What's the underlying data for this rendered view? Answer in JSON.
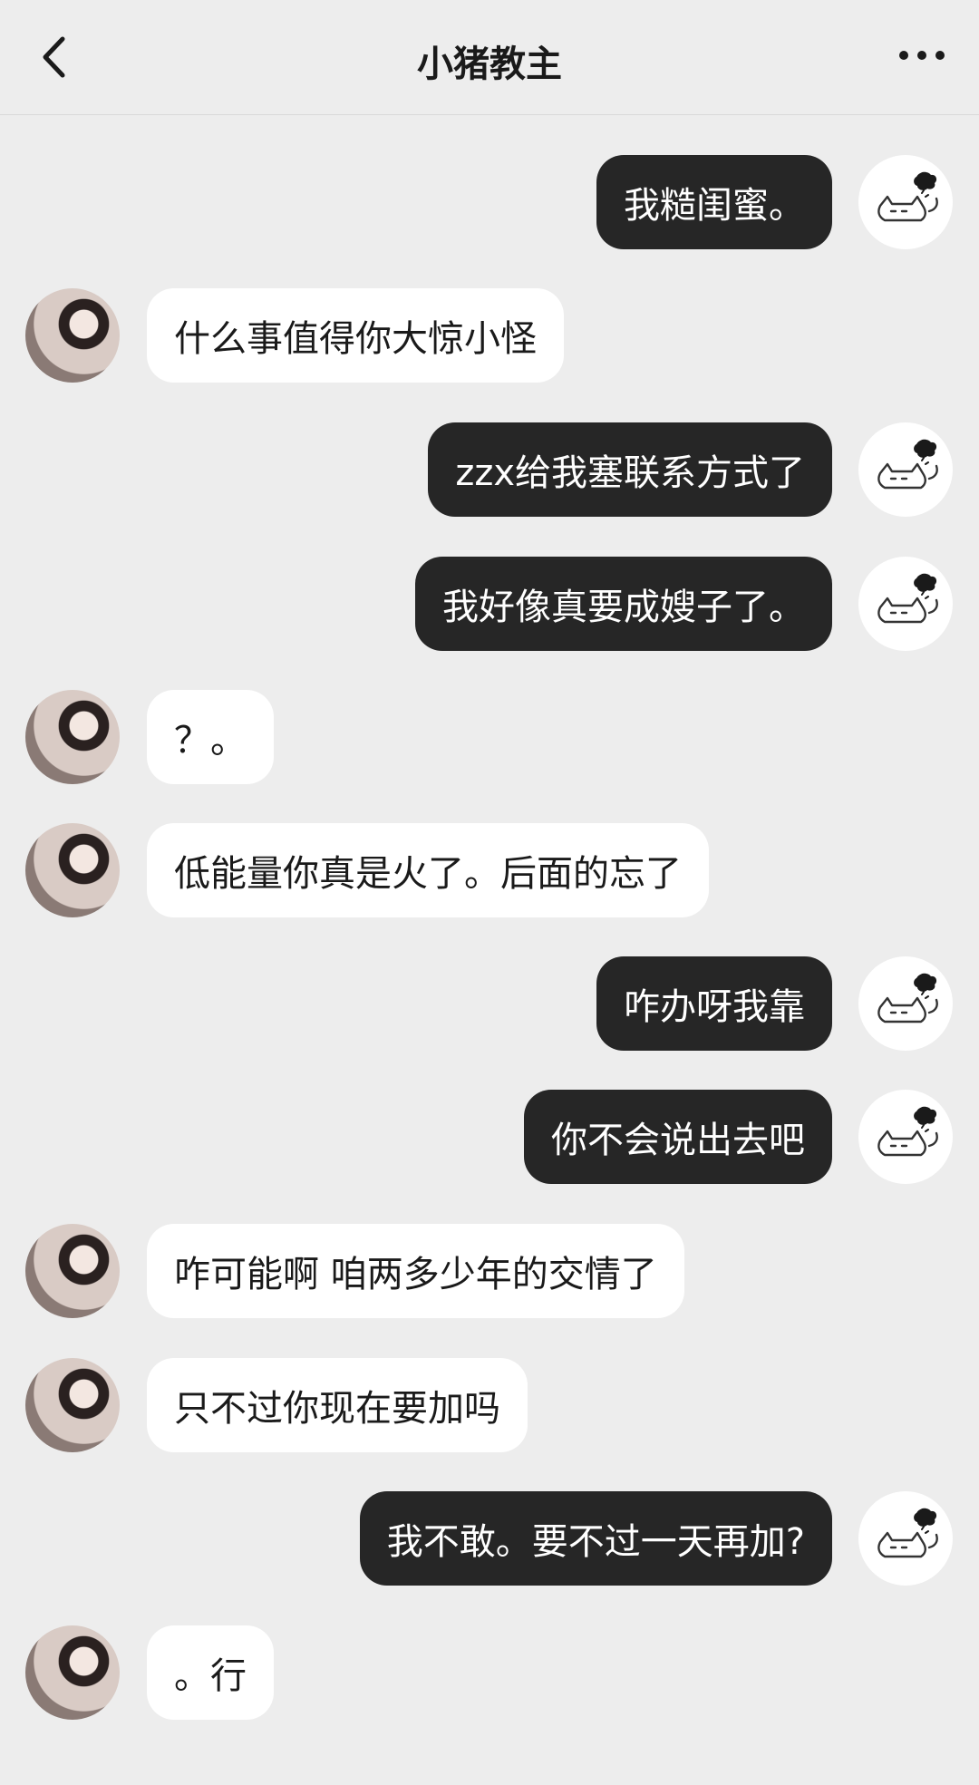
{
  "header": {
    "title": "小猪教主",
    "back_icon": "chevron-left-icon",
    "more_icon": "more-dots-icon"
  },
  "messages": [
    {
      "side": "right",
      "text": "我糙闺蜜。"
    },
    {
      "side": "left",
      "text": "什么事值得你大惊小怪"
    },
    {
      "side": "right",
      "text": "zzx给我塞联系方式了"
    },
    {
      "side": "right",
      "text": "我好像真要成嫂子了。"
    },
    {
      "side": "left",
      "text": "？。"
    },
    {
      "side": "left",
      "text": "低能量你真是火了。后面的忘了"
    },
    {
      "side": "right",
      "text": "咋办呀我靠"
    },
    {
      "side": "right",
      "text": "你不会说出去吧"
    },
    {
      "side": "left",
      "text": "咋可能啊 咱两多少年的交情了"
    },
    {
      "side": "left",
      "text": "只不过你现在要加吗"
    },
    {
      "side": "right",
      "text": "我不敢。要不过一天再加?"
    },
    {
      "side": "left",
      "text": "。行"
    }
  ],
  "colors": {
    "background": "#ededed",
    "sent_bubble": "#262626",
    "received_bubble": "#ffffff"
  }
}
